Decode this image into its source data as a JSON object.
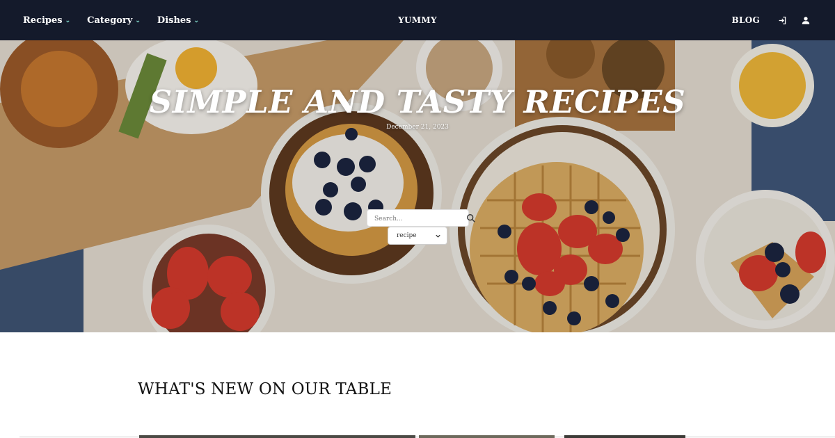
{
  "nav": {
    "items": [
      {
        "label": "Recipes",
        "icon": "chevron-down-icon"
      },
      {
        "label": "Category",
        "icon": "chevron-down-icon"
      },
      {
        "label": "Dishes",
        "icon": "chevron-down-icon"
      }
    ],
    "brand": "YUMMY",
    "blog_label": "BLOG",
    "login_icon": "login-icon",
    "user_icon": "user-icon",
    "accent": "#7fd6c8",
    "background": "#141a2b"
  },
  "hero": {
    "title": "SIMPLE AND TASTY RECIPES",
    "date": "December 21, 2023",
    "search": {
      "placeholder": "Search...",
      "icon": "search-icon"
    },
    "select": {
      "value": "recipe",
      "icon": "chevron-down-icon"
    }
  },
  "section": {
    "title": "WHAT'S NEW ON OUR TABLE"
  }
}
